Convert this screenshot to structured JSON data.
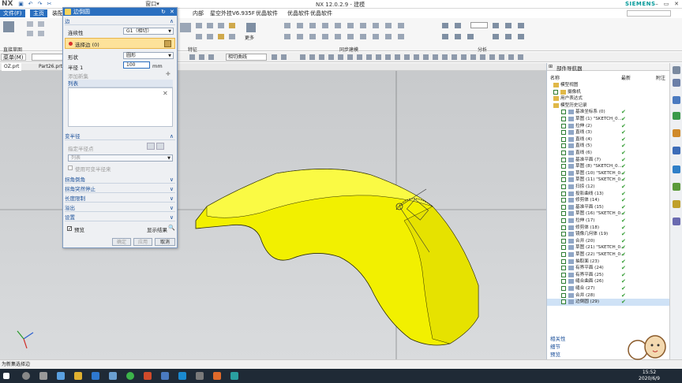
{
  "titlebar": {
    "logo": "NX",
    "title": "NX 12.0.2.9 - 建模",
    "brand": "SIEMENS",
    "window_menu": "窗口"
  },
  "tabs": [
    "文件(F)",
    "主页",
    "装配",
    "曲线",
    "分析",
    "视图",
    "渲染",
    "工具",
    "应用模块",
    "内部",
    "星空外挂V6.935F",
    "优晶软件",
    "优晶软件"
  ],
  "ribbon": {
    "groups": [
      "直接草图",
      "特征",
      "同步建模",
      "分析"
    ],
    "more_label": "更多"
  },
  "selbar": {
    "menu_label": "菜单(M)",
    "filter_value": "",
    "curve_rule": "相切曲线"
  },
  "file_tabs": [
    "OZ.prt",
    "Part26.prt"
  ],
  "dialog": {
    "title": "边倒圆",
    "section_edge": "边",
    "continuity_label": "连续性",
    "continuity_value": "G1（相切）",
    "select_edge": "选择边 (0)",
    "shape_label": "形状",
    "shape_value": "圆形",
    "radius_label": "半径 1",
    "radius_value": "100",
    "radius_unit": "mm",
    "add_set": "添加新集",
    "list_label": "列表",
    "section_variable": "变半径",
    "point_on_edge": "指定半径点",
    "list_label2": "列表",
    "use_varying": "使用可变半径来",
    "section_corner_setback": "拐角倒角",
    "section_corner_stop": "拐角突然停止",
    "section_length_limit": "长度限制",
    "section_overflow": "溢出",
    "section_settings": "设置",
    "preview_label": "预览",
    "show_result": "显示结果",
    "ok": "确定",
    "apply": "应用",
    "cancel": "取消"
  },
  "navigator": {
    "title": "部件导航器",
    "col_name": "名称",
    "col_latest": "最新",
    "col_note": "附注",
    "rows": [
      {
        "text": "模型视图",
        "indent": 0,
        "check": false,
        "latest": false
      },
      {
        "text": "摄像机",
        "indent": 0,
        "check": true,
        "latest": false
      },
      {
        "text": "用户表达式",
        "indent": 0,
        "check": false,
        "latest": false
      },
      {
        "text": "模型历史记录",
        "indent": 0,
        "check": false,
        "latest": false
      },
      {
        "text": "基准坐标系 (0)",
        "indent": 1,
        "check": true,
        "latest": true
      },
      {
        "text": "草图 (1) \"SKETCH_0...",
        "indent": 1,
        "check": true,
        "latest": true
      },
      {
        "text": "拉伸 (2)",
        "indent": 1,
        "check": true,
        "latest": true
      },
      {
        "text": "直线 (3)",
        "indent": 1,
        "check": true,
        "latest": true
      },
      {
        "text": "直线 (4)",
        "indent": 1,
        "check": true,
        "latest": true
      },
      {
        "text": "直线 (5)",
        "indent": 1,
        "check": true,
        "latest": true
      },
      {
        "text": "直线 (6)",
        "indent": 1,
        "check": true,
        "latest": true
      },
      {
        "text": "基准平面 (7)",
        "indent": 1,
        "check": true,
        "latest": true
      },
      {
        "text": "草图 (8) \"SKETCH_0...",
        "indent": 1,
        "check": true,
        "latest": true
      },
      {
        "text": "草图 (10) \"SKETCH_0...",
        "indent": 1,
        "check": true,
        "latest": true
      },
      {
        "text": "草图 (11) \"SKETCH_0...",
        "indent": 1,
        "check": true,
        "latest": true
      },
      {
        "text": "扫掠 (12)",
        "indent": 1,
        "check": true,
        "latest": true
      },
      {
        "text": "投影曲线 (13)",
        "indent": 1,
        "check": true,
        "latest": true
      },
      {
        "text": "修剪体 (14)",
        "indent": 1,
        "check": true,
        "latest": true
      },
      {
        "text": "基准平面 (15)",
        "indent": 1,
        "check": true,
        "latest": true
      },
      {
        "text": "草图 (16) \"SKETCH_0...",
        "indent": 1,
        "check": true,
        "latest": true
      },
      {
        "text": "拉伸 (17)",
        "indent": 1,
        "check": true,
        "latest": true
      },
      {
        "text": "修剪体 (18)",
        "indent": 1,
        "check": true,
        "latest": true
      },
      {
        "text": "镜像几何体 (19)",
        "indent": 1,
        "check": true,
        "latest": true
      },
      {
        "text": "合并 (20)",
        "indent": 1,
        "check": true,
        "latest": true
      },
      {
        "text": "草图 (21) \"SKETCH_0...",
        "indent": 1,
        "check": true,
        "latest": true
      },
      {
        "text": "草图 (22) \"SKETCH_0...",
        "indent": 1,
        "check": true,
        "latest": true
      },
      {
        "text": "抽取面 (23)",
        "indent": 1,
        "check": true,
        "latest": true
      },
      {
        "text": "有界平面 (24)",
        "indent": 1,
        "check": true,
        "latest": true
      },
      {
        "text": "有界平面 (25)",
        "indent": 1,
        "check": true,
        "latest": true
      },
      {
        "text": "缝合曲面 (26)",
        "indent": 1,
        "check": true,
        "latest": true
      },
      {
        "text": "缝合 (27)",
        "indent": 1,
        "check": true,
        "latest": true
      },
      {
        "text": "合并 (28)",
        "indent": 1,
        "check": true,
        "latest": true
      },
      {
        "text": "边倒圆 (29)",
        "indent": 1,
        "check": true,
        "latest": true
      }
    ],
    "footer": [
      "相关性",
      "细节",
      "预览"
    ]
  },
  "status": {
    "text": "为新集选择边"
  },
  "taskbar": {
    "time": "15:52",
    "date": "2020/6/9"
  },
  "colors": {
    "accent": "#2a6fbf",
    "part_yellow": "#f2f000",
    "check_green": "#2e9a2e"
  }
}
